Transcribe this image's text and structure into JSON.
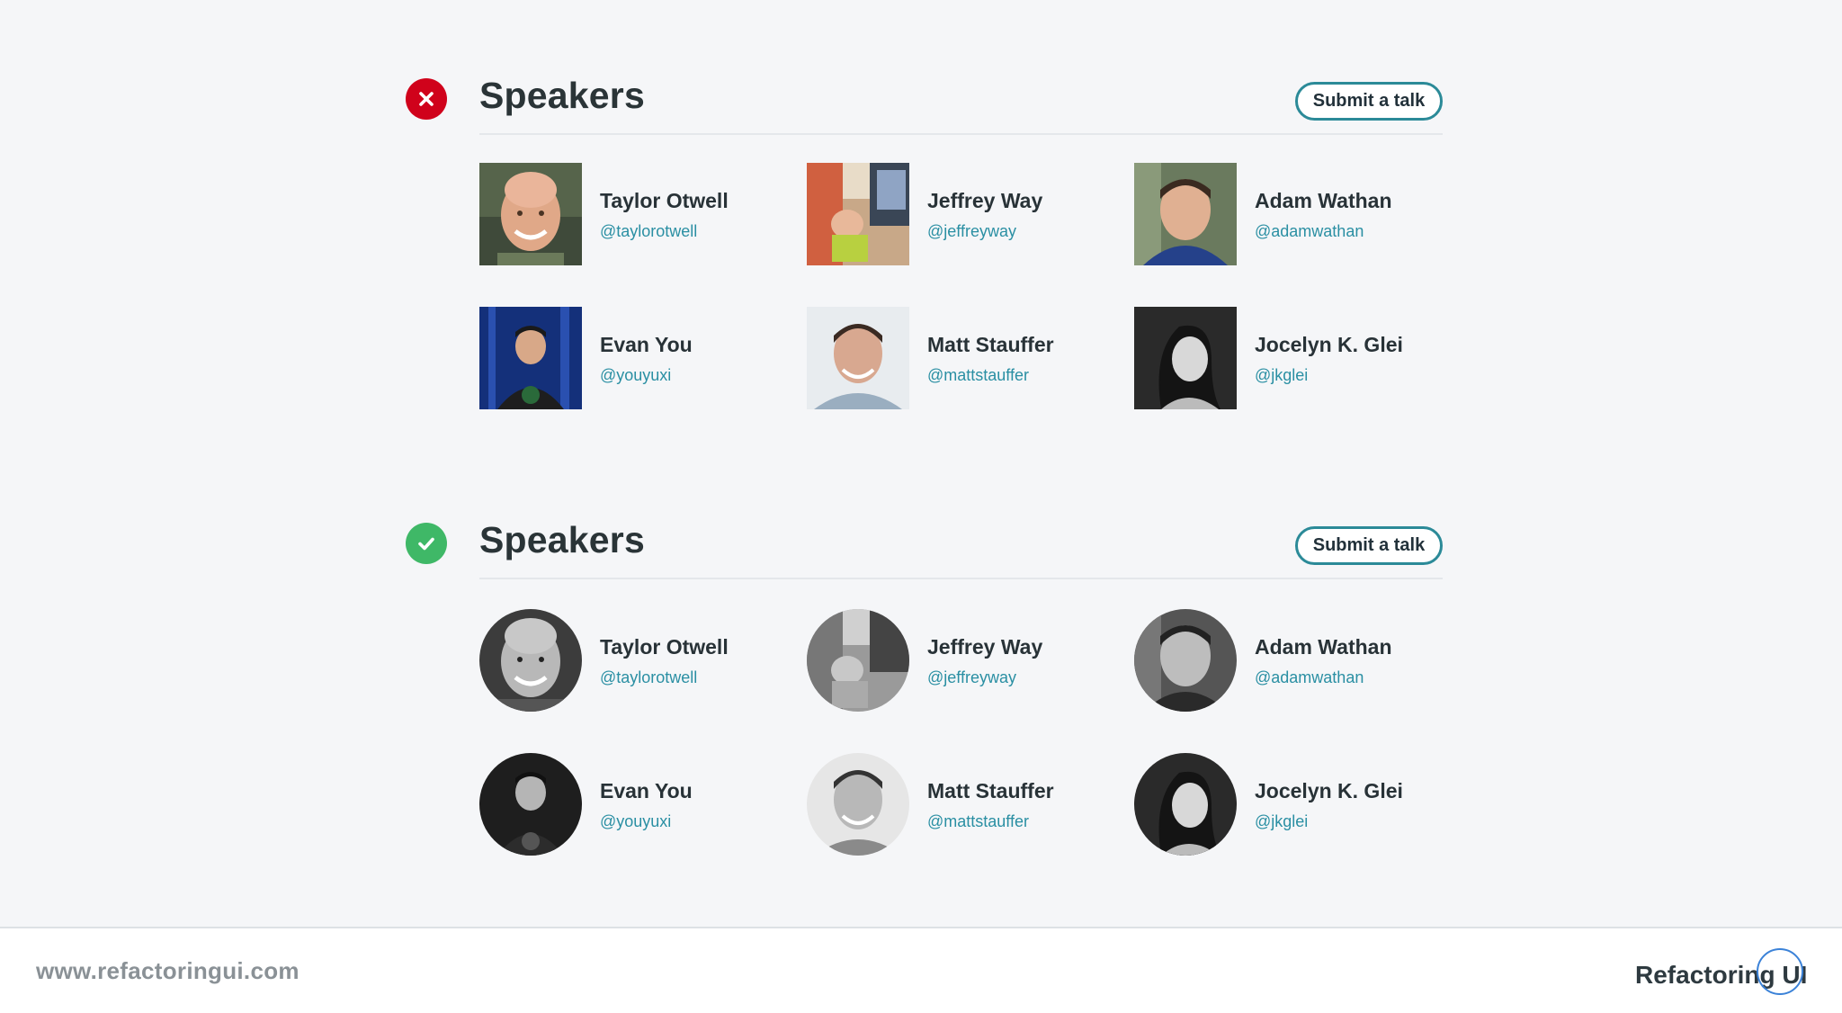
{
  "sections": [
    {
      "variant": "bad",
      "status_icon": "x-icon",
      "status_color": "#d0021b",
      "title": "Speakers",
      "submit_label": "Submit a talk"
    },
    {
      "variant": "good",
      "status_icon": "check-icon",
      "status_color": "#3fb867",
      "title": "Speakers",
      "submit_label": "Submit a talk"
    }
  ],
  "speakers": [
    {
      "name": "Taylor Otwell",
      "handle": "@taylorotwell"
    },
    {
      "name": "Jeffrey Way",
      "handle": "@jeffreyway"
    },
    {
      "name": "Adam Wathan",
      "handle": "@adamwathan"
    },
    {
      "name": "Evan You",
      "handle": "@youyuxi"
    },
    {
      "name": "Matt Stauffer",
      "handle": "@mattstauffer"
    },
    {
      "name": "Jocelyn K. Glei",
      "handle": "@jkglei"
    }
  ],
  "footer": {
    "url": "www.refactoringui.com",
    "brand": "Refactoring UI"
  },
  "colors": {
    "accent": "#2b8a98",
    "handle": "#2a8fa3",
    "background": "#f5f6f8"
  }
}
